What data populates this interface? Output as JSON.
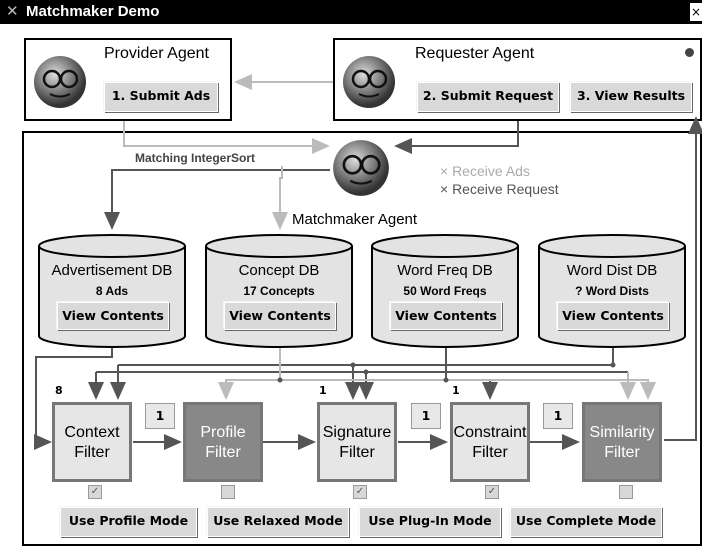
{
  "window": {
    "title": "Matchmaker Demo",
    "close_glyph": "×"
  },
  "provider": {
    "title": "Provider Agent",
    "submit_label": "1. Submit Ads"
  },
  "requester": {
    "title": "Requester Agent",
    "submit_label": "2. Submit Request",
    "view_label": "3. View Results"
  },
  "matchmaker": {
    "title": "Matchmaker Agent",
    "matching_label": "Matching IntegerSort",
    "receive_ads": "× Receive Ads",
    "receive_request": "× Receive Request"
  },
  "databases": [
    {
      "name": "Advertisement DB",
      "count": "8 Ads",
      "button": "View Contents"
    },
    {
      "name": "Concept DB",
      "count": "17 Concepts",
      "button": "View Contents"
    },
    {
      "name": "Word Freq DB",
      "count": "50 Word Freqs",
      "button": "View Contents"
    },
    {
      "name": "Word Dist DB",
      "count": "? Word Dists",
      "button": "View Contents"
    }
  ],
  "filters": [
    {
      "line1": "Context",
      "line2": "Filter",
      "style": "light",
      "top_count": "8",
      "checked": true
    },
    {
      "line1": "Profile",
      "line2": "Filter",
      "style": "dark",
      "top_count": "",
      "checked": false
    },
    {
      "line1": "Signature",
      "line2": "Filter",
      "style": "light",
      "top_count": "1",
      "checked": true
    },
    {
      "line1": "Constraint",
      "line2": "Filter",
      "style": "light",
      "top_count": "1",
      "checked": true
    },
    {
      "line1": "Similarity",
      "line2": "Filter",
      "style": "dark",
      "top_count": "",
      "checked": false
    }
  ],
  "between_counts": [
    "1",
    "1",
    "1"
  ],
  "mode_buttons": [
    "Use Profile Mode",
    "Use Relaxed Mode",
    "Use Plug-In Mode",
    "Use Complete Mode"
  ],
  "icons": {
    "agent": "agent-face-icon",
    "window": "x-window-icon",
    "check": "checkmark-icon"
  },
  "colors": {
    "arrow_dark": "#555555",
    "arrow_light": "#bbbbbb",
    "filter_dark": "#888888",
    "filter_light": "#e6e6e6"
  }
}
